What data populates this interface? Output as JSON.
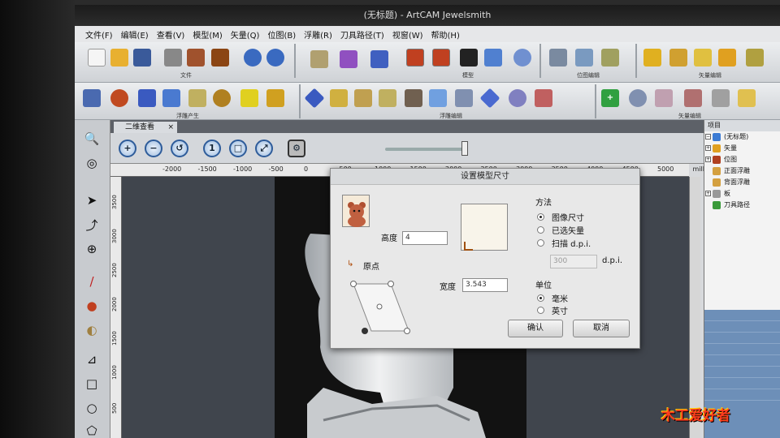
{
  "window": {
    "title": "(无标题) - ArtCAM Jewelsmith"
  },
  "menu": [
    "文件(F)",
    "编辑(E)",
    "查看(V)",
    "模型(M)",
    "矢量(Q)",
    "位图(B)",
    "浮雕(R)",
    "刀具路径(T)",
    "视窗(W)",
    "帮助(H)"
  ],
  "toolbar_groups": {
    "file": "文件",
    "model": "模型",
    "bitmap": "位图编辑",
    "vector": "矢量编辑",
    "relief_create": "浮雕产生",
    "relief_edit": "浮雕编辑",
    "vector_edit2": "矢量编辑"
  },
  "view_tab": {
    "label": "二维查看",
    "close": "×"
  },
  "ruler": {
    "h_ticks": [
      "-2000",
      "-1500",
      "-1000",
      "-500",
      "0",
      "500",
      "1000",
      "1500",
      "2000",
      "2500",
      "3000",
      "3500",
      "4000",
      "4500",
      "5000",
      "millimetres"
    ],
    "v_ticks": [
      "3500",
      "3000",
      "2500",
      "2000",
      "1500",
      "1000",
      "500",
      "0"
    ]
  },
  "project_tree": {
    "header": "项目",
    "items": [
      {
        "label": "(无标题)",
        "icon_color": "#3b7bd4"
      },
      {
        "label": "矢量",
        "icon_color": "#e0a020"
      },
      {
        "label": "位图",
        "icon_color": "#b04020"
      },
      {
        "label": "正面浮雕",
        "icon_color": "#d4a040"
      },
      {
        "label": "背面浮雕",
        "icon_color": "#d4a040"
      },
      {
        "label": "板",
        "icon_color": "#999999"
      },
      {
        "label": "刀具路径",
        "icon_color": "#3a9a3a"
      }
    ]
  },
  "dialog": {
    "title": "设置模型尺寸",
    "height_label": "高度",
    "height_value": "4",
    "width_label": "宽度",
    "width_value": "3.543",
    "origin_label": "原点",
    "method_label": "方法",
    "method_options": [
      "图像尺寸",
      "已选矢量",
      "扫描  d.p.i."
    ],
    "method_selected": "图像尺寸",
    "dpi_value": "300",
    "dpi_unit": "d.p.i.",
    "unit_label": "单位",
    "unit_options": [
      "毫米",
      "英寸"
    ],
    "unit_selected": "毫米",
    "ok_button": "确认",
    "cancel_button": "取消"
  },
  "watermark": "木工爱好者",
  "colors": {
    "accent_blue": "#2e5c9a",
    "canvas_bg": "#40454d",
    "selection_blue": "#6d8fb8"
  }
}
